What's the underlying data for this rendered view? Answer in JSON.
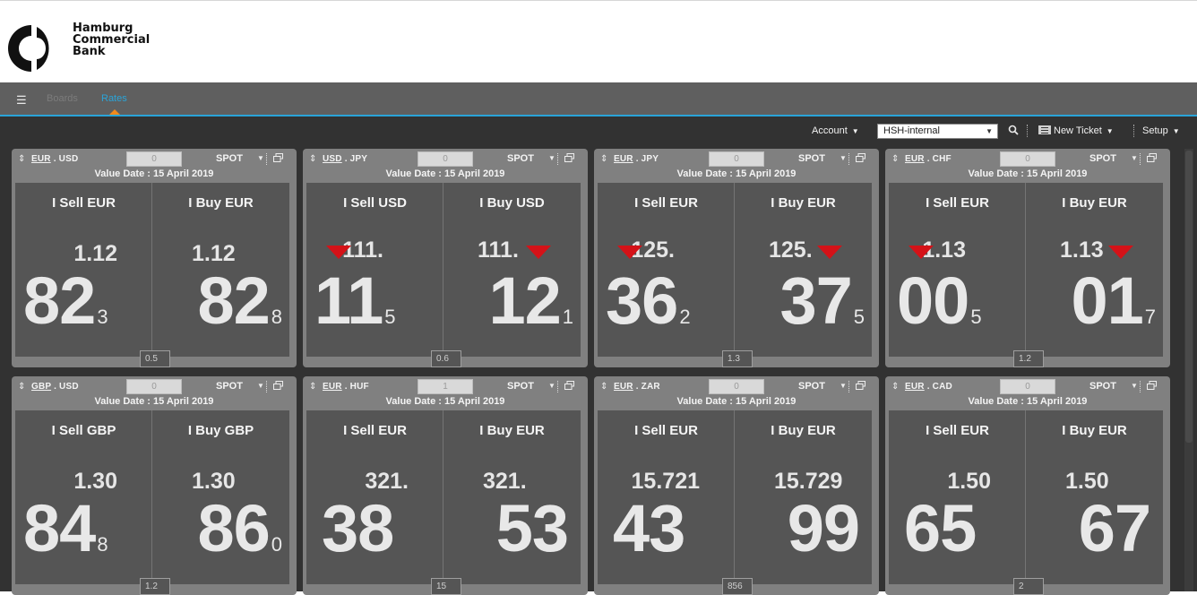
{
  "header": {
    "bank_name_line1": "Hamburg",
    "bank_name_line2": "Commercial",
    "bank_name_line3": "Bank"
  },
  "nav": {
    "menu_icon": "hamburger-menu-icon",
    "tabs": [
      {
        "label": "Boards",
        "active": false
      },
      {
        "label": "Rates",
        "active": true
      }
    ],
    "accent_color": "#2aa4d8",
    "caret_color": "#f08a1c"
  },
  "toolbar": {
    "account_label": "Account",
    "account_value": "HSH-internal",
    "search_icon": "magnifier-icon",
    "new_ticket_label": "New Ticket",
    "setup_label": "Setup"
  },
  "colors": {
    "down_arrow": "#d41218",
    "tile_bg": "#808080",
    "panel_bg": "#555555"
  },
  "tiles": [
    {
      "base": "EUR",
      "quote": "USD",
      "amount": "0",
      "tenor": "SPOT",
      "value_date": "Value Date : 15 April 2019",
      "sell": {
        "label": "I Sell EUR",
        "big": "1.12",
        "pips": "82",
        "frac": "3",
        "arrow": false
      },
      "buy": {
        "label": "I Buy EUR",
        "big": "1.12",
        "pips": "82",
        "frac": "8",
        "arrow": false
      },
      "spread": "0.5"
    },
    {
      "base": "USD",
      "quote": "JPY",
      "amount": "0",
      "tenor": "SPOT",
      "value_date": "Value Date : 15 April 2019",
      "sell": {
        "label": "I Sell USD",
        "big": "111.",
        "pips": "11",
        "frac": "5",
        "arrow": true
      },
      "buy": {
        "label": "I Buy USD",
        "big": "111.",
        "pips": "12",
        "frac": "1",
        "arrow": true
      },
      "spread": "0.6"
    },
    {
      "base": "EUR",
      "quote": "JPY",
      "amount": "0",
      "tenor": "SPOT",
      "value_date": "Value Date : 15 April 2019",
      "sell": {
        "label": "I Sell EUR",
        "big": "125.",
        "pips": "36",
        "frac": "2",
        "arrow": true
      },
      "buy": {
        "label": "I Buy EUR",
        "big": "125.",
        "pips": "37",
        "frac": "5",
        "arrow": true
      },
      "spread": "1.3"
    },
    {
      "base": "EUR",
      "quote": "CHF",
      "amount": "0",
      "tenor": "SPOT",
      "value_date": "Value Date : 15 April 2019",
      "sell": {
        "label": "I Sell EUR",
        "big": "1.13",
        "pips": "00",
        "frac": "5",
        "arrow": true
      },
      "buy": {
        "label": "I Buy EUR",
        "big": "1.13",
        "pips": "01",
        "frac": "7",
        "arrow": true
      },
      "spread": "1.2"
    },
    {
      "base": "GBP",
      "quote": "USD",
      "amount": "0",
      "tenor": "SPOT",
      "value_date": "Value Date : 15 April 2019",
      "sell": {
        "label": "I Sell GBP",
        "big": "1.30",
        "pips": "84",
        "frac": "8",
        "arrow": false
      },
      "buy": {
        "label": "I Buy GBP",
        "big": "1.30",
        "pips": "86",
        "frac": "0",
        "arrow": false
      },
      "spread": "1.2"
    },
    {
      "base": "EUR",
      "quote": "HUF",
      "amount": "1",
      "tenor": "SPOT",
      "value_date": "Value Date : 15 April 2019",
      "sell": {
        "label": "I Sell EUR",
        "big": "321.",
        "pips": "38",
        "frac": "",
        "arrow": false
      },
      "buy": {
        "label": "I Buy EUR",
        "big": "321.",
        "pips": "53",
        "frac": "",
        "arrow": false
      },
      "spread": "15"
    },
    {
      "base": "EUR",
      "quote": "ZAR",
      "amount": "0",
      "tenor": "SPOT",
      "value_date": "Value Date : 15 April 2019",
      "sell": {
        "label": "I Sell EUR",
        "big": "15.721",
        "pips": "43",
        "frac": "",
        "arrow": false
      },
      "buy": {
        "label": "I Buy EUR",
        "big": "15.729",
        "pips": "99",
        "frac": "",
        "arrow": false
      },
      "spread": "856"
    },
    {
      "base": "EUR",
      "quote": "CAD",
      "amount": "0",
      "tenor": "SPOT",
      "value_date": "Value Date : 15 April 2019",
      "sell": {
        "label": "I Sell EUR",
        "big": "1.50",
        "pips": "65",
        "frac": "",
        "arrow": false
      },
      "buy": {
        "label": "I Buy EUR",
        "big": "1.50",
        "pips": "67",
        "frac": "",
        "arrow": false
      },
      "spread": "2"
    }
  ]
}
